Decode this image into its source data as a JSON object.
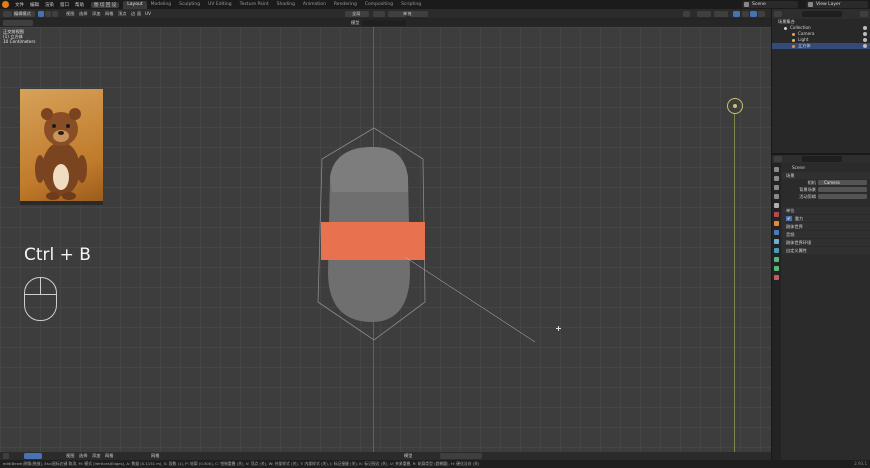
{
  "topbar": {
    "menus": [
      "文件",
      "编辑",
      "渲染",
      "窗口",
      "帮助"
    ],
    "render_label": "图 切 回 设",
    "workspaces": [
      "Layout",
      "Modeling",
      "Sculpting",
      "UV Editing",
      "Texture Paint",
      "Shading",
      "Animation",
      "Rendering",
      "Compositing",
      "Scripting"
    ],
    "active_workspace": "Layout",
    "scene": "Scene",
    "view_layer": "View Layer"
  },
  "viewport_header": {
    "mode": "编辑模式",
    "menus": [
      "视图",
      "选择",
      "添加",
      "网格",
      "顶点",
      "边",
      "面",
      "UV"
    ],
    "transform_orientation": "全局",
    "snap_label": "",
    "proportional_label": "",
    "pivot": "单独",
    "header2_left": "模型",
    "header2_search": ""
  },
  "viewport": {
    "info_line1": "正交前视图",
    "info_line2": "(1) 立方体",
    "info_line3": "10 Centimeters",
    "shortcut_text": "Ctrl + B",
    "reference_image": "bear-reference-image"
  },
  "viewport_footer": {
    "items": [
      "视图",
      "选择",
      "添加",
      "网格",
      "顶点",
      "边",
      "面",
      "UV"
    ],
    "right": [
      "模型",
      "网格"
    ]
  },
  "outliner": {
    "title": "场景集合",
    "rows": [
      {
        "label": "Collection",
        "color": "#d0d0d0",
        "selected": false,
        "indent": 6
      },
      {
        "label": "Camera",
        "color": "#d9a36a",
        "selected": false,
        "indent": 14
      },
      {
        "label": "Light",
        "color": "#d9c06a",
        "selected": false,
        "indent": 14
      },
      {
        "label": "立方体",
        "color": "#e0924f",
        "selected": true,
        "indent": 14
      }
    ]
  },
  "properties": {
    "header": "Scene",
    "section_scene": "场景",
    "rows": [
      {
        "label": "相机",
        "value": "Camera"
      },
      {
        "label": "背景场景",
        "value": ""
      },
      {
        "label": "活动剪辑",
        "value": ""
      }
    ],
    "panels": [
      "单位",
      "重力",
      "刚体世界",
      "音频",
      "刚体世界环境",
      "自定义属性"
    ],
    "gravity_checked": "✔"
  },
  "statusbar": {
    "text": "edit(Bevel)倒角(拖放), Esc/鼠标右键 取消, M: 模式 (Vertices/Edges), A: 数量 (0.1151 m), S: 段数 (1), P: 轮廓 (0.500), C: 钳制重叠 (关), V: 顶点 (关), W: 外部样式 (关), T: 内部样式 (关), J: 标记接缝 (关), K: 标记锐边 (关), U: 夹紧重叠, R: 轮廓类型 (超椭圆), H: 硬化法向 (关)",
    "version": "2.93.1"
  },
  "colors": {
    "accent": "#4772b3",
    "selection": "#e8714f",
    "mesh": "#6f6f6f",
    "camera": "#c9c270"
  }
}
